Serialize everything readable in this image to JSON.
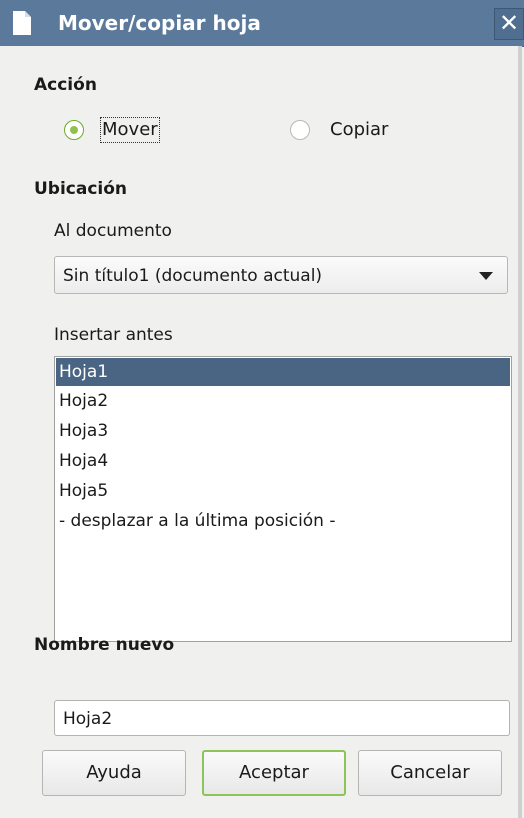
{
  "window": {
    "title": "Mover/copiar hoja",
    "close_symbol": "✕"
  },
  "action": {
    "heading": "Acción",
    "options": [
      {
        "label": "Mover",
        "checked": true
      },
      {
        "label": "Copiar",
        "checked": false
      }
    ]
  },
  "location": {
    "heading": "Ubicación",
    "document_label": "Al documento",
    "document_selected": "Sin título1 (documento actual)",
    "insert_before_label": "Insertar antes",
    "sheets": [
      "Hoja1",
      "Hoja2",
      "Hoja3",
      "Hoja4",
      "Hoja5",
      "- desplazar a la última posición -"
    ],
    "selected_index": 0
  },
  "new_name": {
    "heading": "Nombre nuevo",
    "value": "Hoja2"
  },
  "buttons": {
    "help": "Ayuda",
    "ok": "Aceptar",
    "cancel": "Cancelar"
  },
  "icons": {
    "title_icon": "document-icon",
    "close_icon": "close-icon",
    "dropdown_icon": "chevron-down-icon"
  },
  "colors": {
    "titlebar": "#5b7a9b",
    "selection": "#4a6583",
    "radio_checked": "#8fc24d",
    "default_button_border": "#8cc45a"
  }
}
